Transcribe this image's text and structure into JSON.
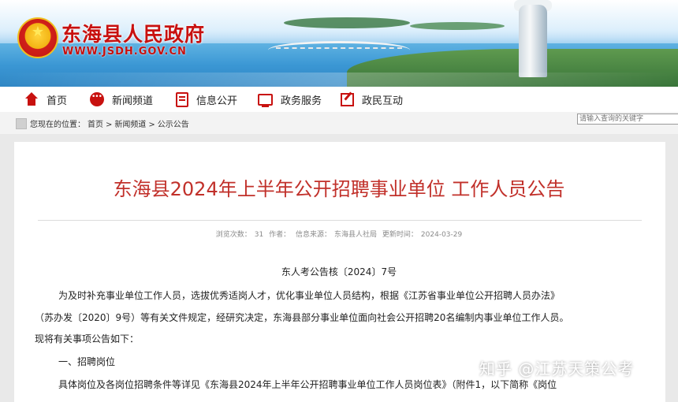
{
  "site": {
    "name": "东海县人民政府",
    "url": "WWW.JSDH.GOV.CN"
  },
  "nav": {
    "items": [
      {
        "label": "首页"
      },
      {
        "label": "新闻频道"
      },
      {
        "label": "信息公开"
      },
      {
        "label": "政务服务"
      },
      {
        "label": "政民互动"
      }
    ]
  },
  "breadcrumb": {
    "prefix": "您现在的位置：",
    "items": [
      "首页",
      "新闻频道",
      "公示公告"
    ],
    "separator": ">"
  },
  "search": {
    "placeholder": "请输入查询的关键字"
  },
  "article": {
    "title": "东海县2024年上半年公开招聘事业单位 工作人员公告",
    "meta": {
      "views_label": "浏览次数：",
      "views": "31",
      "author_label": "作者：",
      "source_label": "信息来源：",
      "source": "东海县人社局",
      "date_label": "更新时间：",
      "date": "2024-03-29"
    },
    "doc_number": "东人考公告核〔2024〕7号",
    "lines": [
      "为及时补充事业单位工作人员，选拔优秀适岗人才，优化事业单位人员结构，根据《江苏省事业单位公开招聘人员办法》",
      "（苏办发〔2020〕9号）等有关文件规定，经研究决定，东海县部分事业单位面向社会公开招聘20名编制内事业单位工作人员。",
      "现将有关事项公告如下：",
      "一、招聘岗位",
      "具体岗位及各岗位招聘条件等详见《东海县2024年上半年公开招聘事业单位工作人员岗位表》（附件1，以下简称《岗位"
    ]
  },
  "watermark": "知乎 @江苏天策公考",
  "colors": {
    "brand_red": "#c8110f",
    "title_red": "#c1302a"
  }
}
